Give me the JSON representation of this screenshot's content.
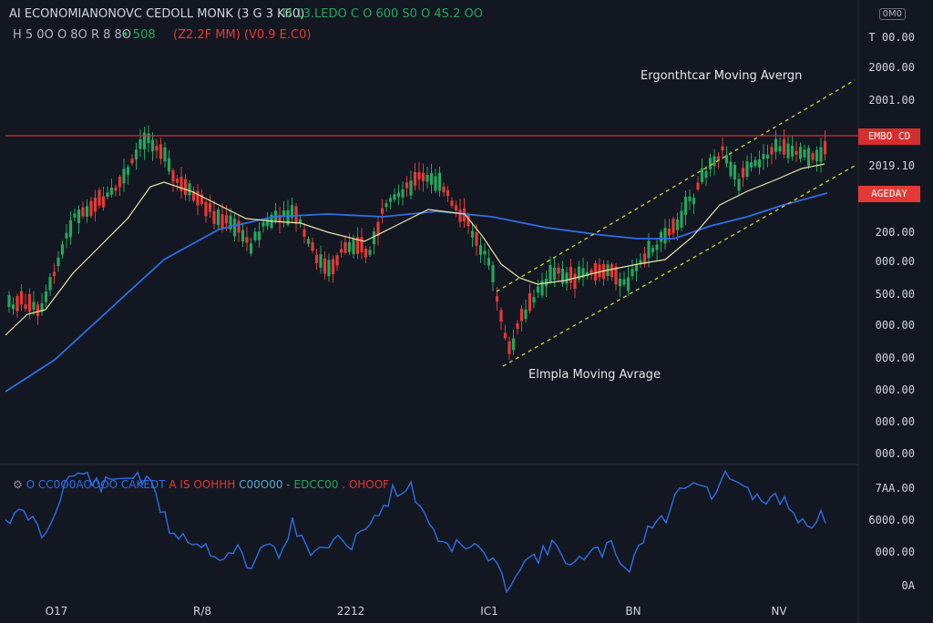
{
  "header": {
    "symbol": "AI ECONOMIANONOVC CEDOLL MONK (3 G 3 K60)",
    "ohlc_green": "O 13.LEDO  C O 600 S0  O 4S.2 OO",
    "line2_left": "H 5 0O  O 8O  R 8 8O",
    "line2_green": "• 508",
    "line2_red": "(Z2.2F MM) (V0.9 E.C0)",
    "corner_button": "0M0"
  },
  "indicator_header": {
    "icon": "gear-icon",
    "label": "O CC0O0AOOOO CAKEDT",
    "value1": "A IS OOHHH",
    "value2": "C00O00",
    "value3": "- EDCC00",
    "value4": ". OHOOF"
  },
  "price_tags": {
    "resistance": "EMBO  CD",
    "ma": "AGEDAY"
  },
  "annotations": {
    "ema": "Ergonthtcar  Moving  Avergn",
    "sma": "Elmpla  Moving  Avrage"
  },
  "colors": {
    "background": "#131722",
    "up": "#26a65b",
    "down": "#e53935",
    "ema_line": "#e9e6a6",
    "sma_line": "#2f6ee4",
    "channel": "#d4d43a",
    "resistance": "#d32f2f",
    "oscillator": "#2f6ee4"
  },
  "chart_data": {
    "type": "candlestick",
    "y_axis_labels": [
      "T 00.00",
      "2000.00",
      "2001.00",
      "2019.10",
      "200.00",
      "000.00",
      "500.00",
      "000.00",
      "000.00",
      "000.00",
      "000.00",
      "000.00"
    ],
    "oscillator_axis_labels": [
      "7AA.00",
      "6000.00",
      "000.00",
      "0A"
    ],
    "x_axis_labels": [
      "O17",
      "R/8",
      "2212",
      "IC1",
      "BN",
      "NV"
    ],
    "grid": false,
    "indicators": [
      "Exponential Moving Average",
      "Simple Moving Average",
      "Ascending channel",
      "Horizontal resistance line",
      "Oscillator subpanel"
    ]
  }
}
